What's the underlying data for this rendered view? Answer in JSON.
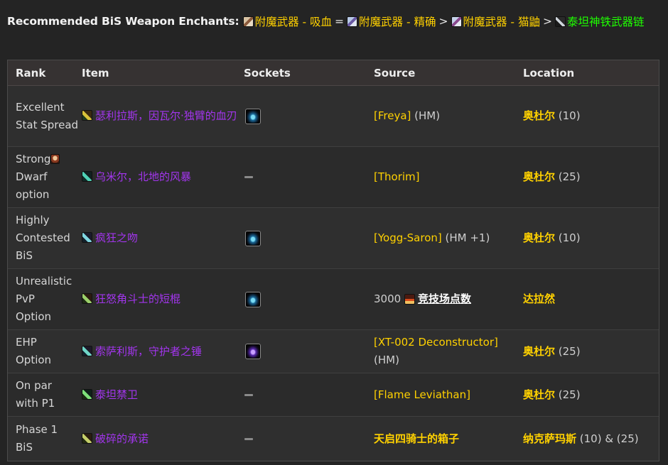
{
  "header": {
    "lead": "Recommended BiS Weapon Enchants:",
    "chain": [
      {
        "label": "附魔武器 - 吸血",
        "icon": "scroll-icon",
        "sep": "="
      },
      {
        "label": "附魔武器 - 精确",
        "icon": "scroll-icon",
        "sep": ">"
      },
      {
        "label": "附魔武器 - 猫鼬",
        "icon": "scroll-icon",
        "sep": ">"
      },
      {
        "label": "泰坦神铁武器链",
        "icon": "chain-icon",
        "sep": ""
      }
    ]
  },
  "table": {
    "columns": [
      "Rank",
      "Item",
      "Sockets",
      "Source",
      "Location"
    ],
    "rows": [
      {
        "rank": "Excellent Stat Spread",
        "item": "瑟利拉斯，因瓦尔·独臂的血刃",
        "icon": "sword-icon",
        "socket": "blue-gem",
        "source": "[Freya]",
        "source_suffix": " (HM)",
        "zone": "奥杜尔",
        "zone_suffix": " (10)"
      },
      {
        "rank": "Strong",
        "rank_suffix": "Dwarf option",
        "item": "乌米尔，北地的风暴",
        "icon": "sword-icon",
        "socket": "none",
        "source": "[Thorim]",
        "source_suffix": "",
        "zone": "奥杜尔",
        "zone_suffix": " (25)"
      },
      {
        "rank": "Highly Contested BiS",
        "item": "疯狂之吻",
        "icon": "sword-icon",
        "socket": "blue-gem",
        "source": "[Yogg-Saron]",
        "source_suffix": " (HM +1)",
        "zone": "奥杜尔",
        "zone_suffix": " (10)"
      },
      {
        "rank": "Unrealistic PvP Option",
        "item": "狂怒角斗士的短棍",
        "icon": "mace-icon",
        "socket": "blue-gem",
        "source_prefix": "3000 ",
        "source_arena": "竞技场点数",
        "zone": "达拉然",
        "zone_suffix": ""
      },
      {
        "rank": "EHP Option",
        "item": "索萨利斯，守护者之锤",
        "icon": "hammer-icon",
        "socket": "purple-gem",
        "source": "[XT-002 Deconstructor]",
        "source_suffix": "(HM)",
        "zone": "奥杜尔",
        "zone_suffix": " (25)"
      },
      {
        "rank": "On par with P1",
        "item": "泰坦禁卫",
        "icon": "sword-icon",
        "socket": "none",
        "source": "[Flame Leviathan]",
        "source_suffix": "",
        "zone": "奥杜尔",
        "zone_suffix": " (25)"
      },
      {
        "rank": "Phase 1 BiS",
        "item": "破碎的承诺",
        "icon": "sword-icon",
        "socket": "none",
        "source_chest": "天启四骑士的箱子",
        "zone": "纳克萨玛斯",
        "zone_suffix": " (10) & (25)"
      }
    ]
  },
  "colors": {
    "epic": "#a335ee",
    "legendary_yellow": "#ffd100",
    "uncommon_green": "#1eff00"
  }
}
